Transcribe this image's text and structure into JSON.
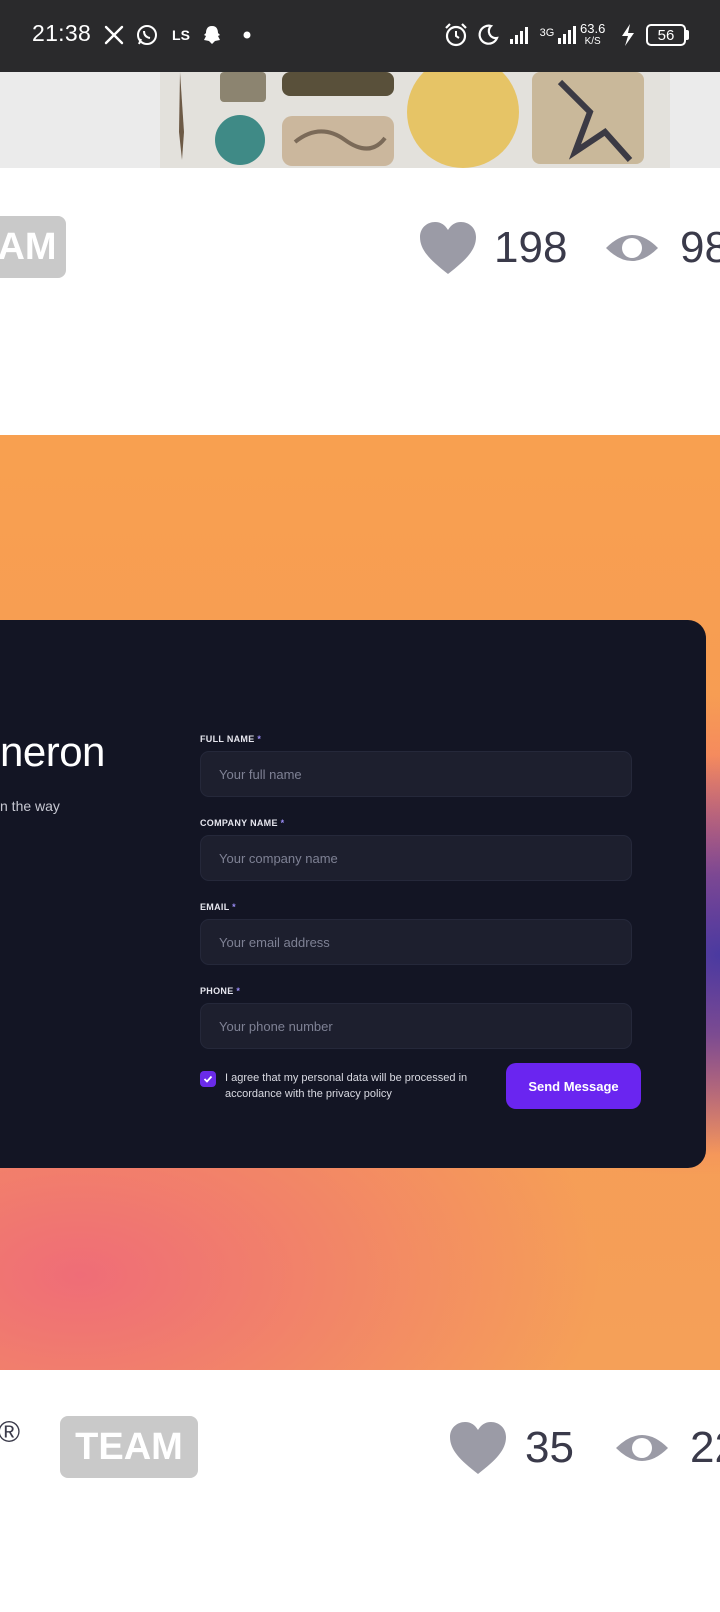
{
  "status_bar": {
    "time": "21:38",
    "net_speed_value": "63.6",
    "net_speed_unit": "K/S",
    "network_label": "3G",
    "battery": "56",
    "icons": [
      "x-icon",
      "whatsapp-icon",
      "ls-icon",
      "snapchat-icon",
      "dot-icon",
      "alarm-icon",
      "moon-icon",
      "signal-icon",
      "charging-icon"
    ]
  },
  "post1": {
    "badge": "AM",
    "likes": "198",
    "views": "98"
  },
  "hero": {
    "heading": "neron",
    "subtext": "n the way",
    "form": {
      "full_name_label": "FULL NAME",
      "full_name_placeholder": "Your full name",
      "company_label": "COMPANY NAME",
      "company_placeholder": "Your company name",
      "email_label": "EMAIL",
      "email_placeholder": "Your email address",
      "phone_label": "PHONE",
      "phone_placeholder": "Your phone number",
      "required_mark": "*",
      "consent": "I agree that my personal data will be processed in accordance with the privacy policy",
      "consent_checked": true,
      "submit": "Send Message"
    }
  },
  "post2": {
    "registered_mark": "®",
    "badge": "TEAM",
    "likes": "35",
    "views": "22"
  },
  "colors": {
    "accent": "#6a25f0",
    "card": "#131524",
    "status_bar": "#2a2a2c",
    "badge": "#c9c9c9",
    "stat_icon": "#9b9ba6"
  }
}
